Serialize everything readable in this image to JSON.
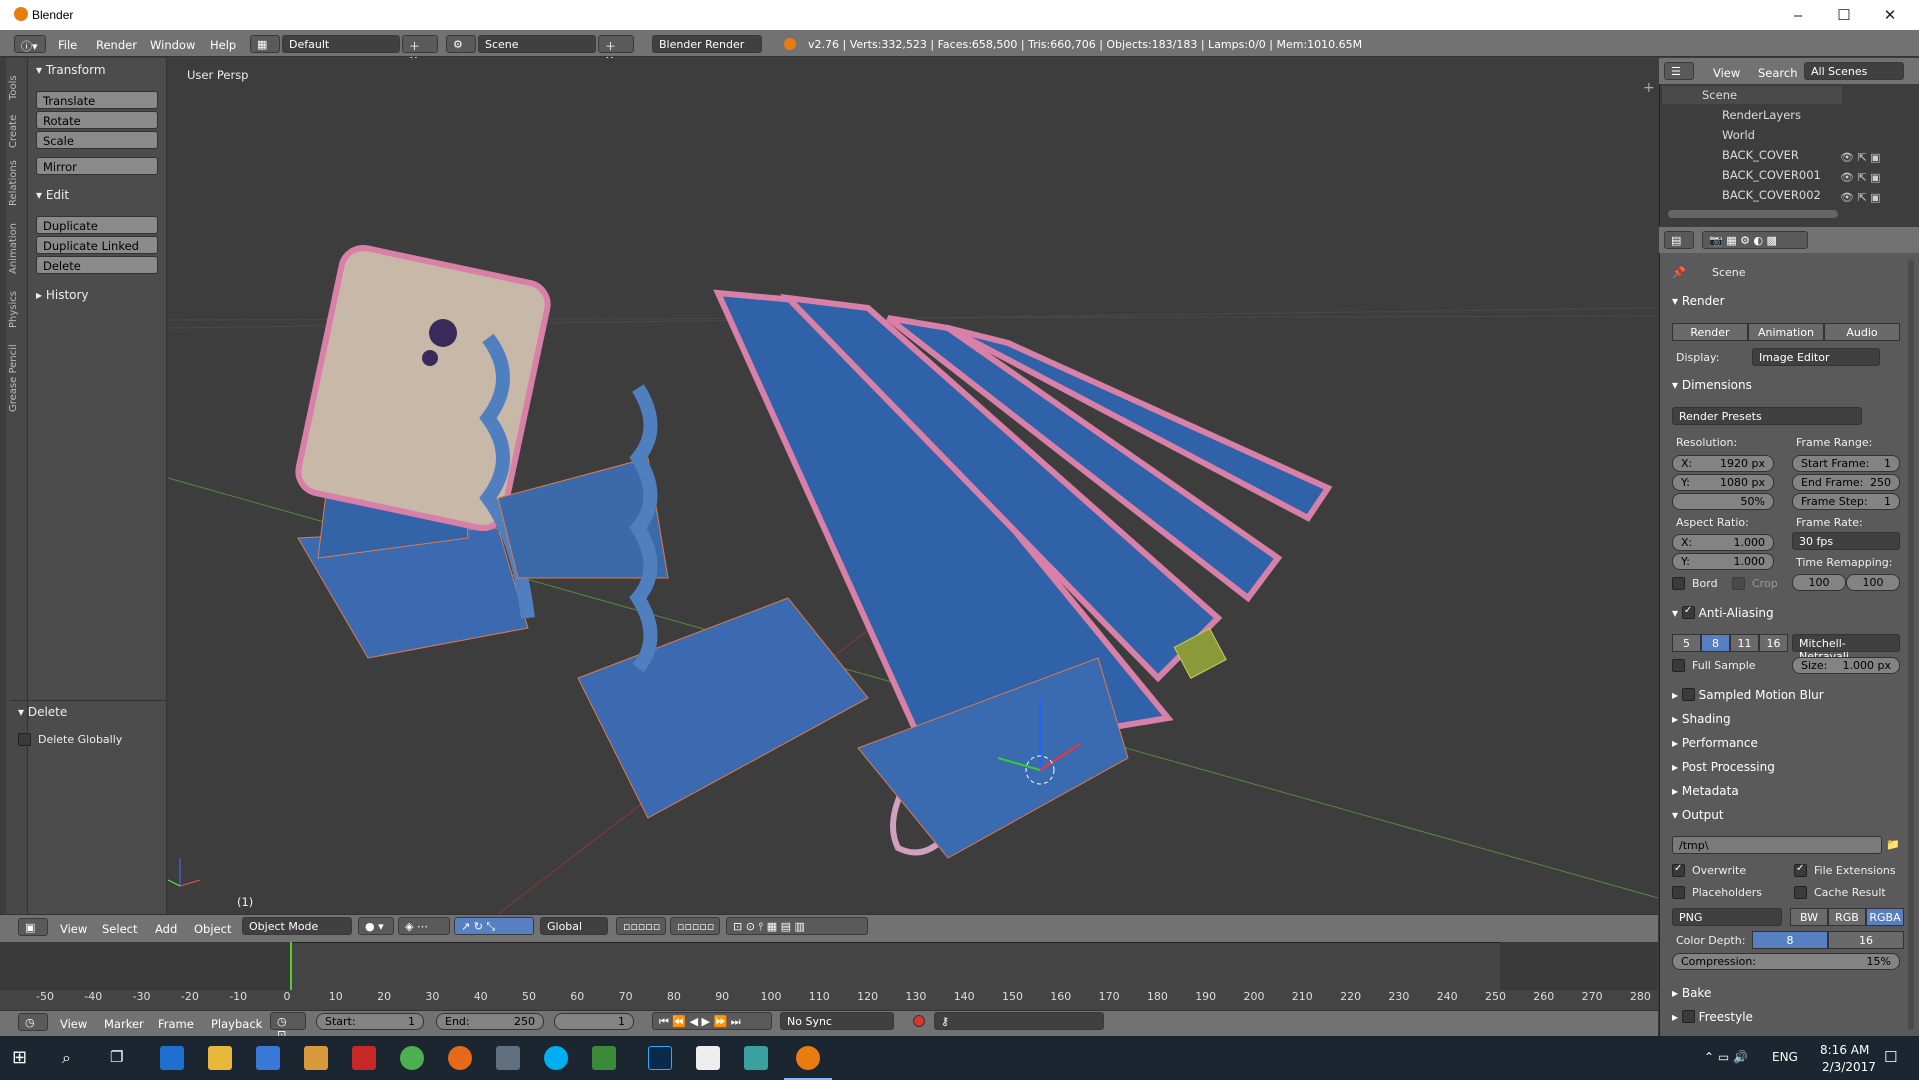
{
  "window": {
    "title": "Blender"
  },
  "menu": {
    "file": "File",
    "render": "Render",
    "window": "Window",
    "help": "Help"
  },
  "layout": {
    "screen": "Default",
    "scene": "Scene",
    "engine": "Blender Render"
  },
  "stats": "v2.76 | Verts:332,523 | Faces:658,500 | Tris:660,706 | Objects:183/183 | Lamps:0/0 | Mem:1010.65M",
  "lefttabs": [
    "Tools",
    "Create",
    "Relations",
    "Animation",
    "Physics",
    "Grease Pencil"
  ],
  "toolshelf": {
    "transform_title": "Transform",
    "translate": "Translate",
    "rotate": "Rotate",
    "scale": "Scale",
    "mirror": "Mirror",
    "edit_title": "Edit",
    "duplicate": "Duplicate",
    "duplicate_linked": "Duplicate Linked",
    "delete": "Delete",
    "history_title": "History",
    "op_title": "Delete",
    "delete_globally": "Delete Globally"
  },
  "viewport": {
    "view_name": "User Persp",
    "frame_label": "(1)"
  },
  "vphdr": {
    "view": "View",
    "select": "Select",
    "add": "Add",
    "object": "Object",
    "mode": "Object Mode",
    "orientation": "Global"
  },
  "timeline": {
    "ticks": [
      "-50",
      "-40",
      "-30",
      "-20",
      "-10",
      "0",
      "10",
      "20",
      "30",
      "40",
      "50",
      "60",
      "70",
      "80",
      "90",
      "100",
      "110",
      "120",
      "130",
      "140",
      "150",
      "160",
      "170",
      "180",
      "190",
      "200",
      "210",
      "220",
      "230",
      "240",
      "250",
      "260",
      "270",
      "280"
    ],
    "view": "View",
    "marker": "Marker",
    "frame": "Frame",
    "playback": "Playback",
    "start_label": "Start:",
    "start": "1",
    "end_label": "End:",
    "end": "250",
    "current": "1",
    "sync": "No Sync"
  },
  "outliner": {
    "view": "View",
    "search": "Search",
    "filter": "All Scenes",
    "rows": [
      "Scene",
      "RenderLayers",
      "World",
      "BACK_COVER",
      "BACK_COVER001",
      "BACK_COVER002"
    ]
  },
  "props": {
    "context": "Scene",
    "render_title": "Render",
    "render_btn": "Render",
    "animation_btn": "Animation",
    "audio_btn": "Audio",
    "display_label": "Display:",
    "display_value": "Image Editor",
    "dimensions_title": "Dimensions",
    "render_presets": "Render Presets",
    "resolution_label": "Resolution:",
    "res_x_k": "X:",
    "res_x": "1920 px",
    "res_y_k": "Y:",
    "res_y": "1080 px",
    "res_pct": "50%",
    "frame_range_label": "Frame Range:",
    "start_frame_k": "Start Frame:",
    "start_frame": "1",
    "end_frame_k": "End Frame:",
    "end_frame": "250",
    "frame_step_k": "Frame Step:",
    "frame_step": "1",
    "aspect_label": "Aspect Ratio:",
    "asp_x_k": "X:",
    "asp_x": "1.000",
    "asp_y_k": "Y:",
    "asp_y": "1.000",
    "frame_rate_label": "Frame Rate:",
    "frame_rate": "30 fps",
    "time_remap_label": "Time Remapping:",
    "remap_old": "100",
    "remap_new": "100",
    "bord": "Bord",
    "crop": "Crop",
    "aa_title": "Anti-Aliasing",
    "aa_samples": [
      "5",
      "8",
      "11",
      "16"
    ],
    "aa_filter": "Mitchell-Netravali",
    "full_sample": "Full Sample",
    "size_k": "Size:",
    "size": "1.000 px",
    "smb_title": "Sampled Motion Blur",
    "shading_title": "Shading",
    "performance_title": "Performance",
    "post_title": "Post Processing",
    "metadata_title": "Metadata",
    "output_title": "Output",
    "output_path": "/tmp\\",
    "overwrite": "Overwrite",
    "file_ext": "File Extensions",
    "placeholders": "Placeholders",
    "cache_result": "Cache Result",
    "format": "PNG",
    "bw": "BW",
    "rgb": "RGB",
    "rgba": "RGBA",
    "color_depth_label": "Color Depth:",
    "depth_8": "8",
    "depth_16": "16",
    "compression_k": "Compression:",
    "compression": "15%",
    "bake_title": "Bake",
    "freestyle_title": "Freestyle"
  },
  "taskbar": {
    "lang": "ENG",
    "time": "8:16 AM",
    "date": "2/3/2017"
  }
}
